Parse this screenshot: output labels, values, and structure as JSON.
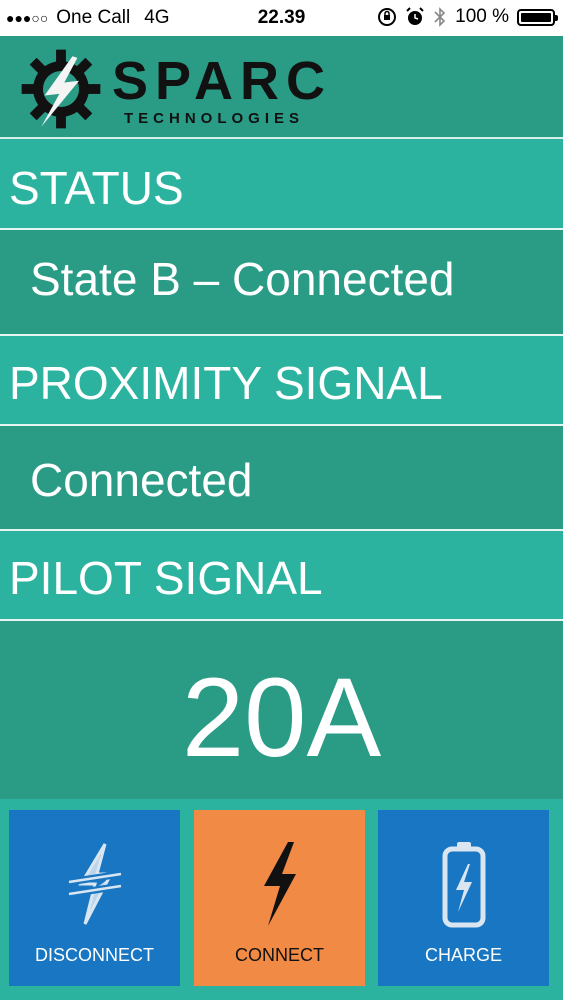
{
  "status_bar": {
    "signal_dots": "●●●○○",
    "carrier": "One Call",
    "network": "4G",
    "time": "22.39",
    "battery": "100 %"
  },
  "header": {
    "brand_name": "SPARC",
    "brand_sub": "TECHNOLOGIES"
  },
  "status": {
    "label": "STATUS",
    "value": "State B – Connected"
  },
  "proximity": {
    "label": "PROXIMITY SIGNAL",
    "value": "Connected"
  },
  "pilot": {
    "label": "PILOT SIGNAL",
    "value": "20A"
  },
  "buttons": {
    "disconnect": "DISCONNECT",
    "connect": "CONNECT",
    "charge": "CHARGE"
  },
  "colors": {
    "header_bg": "#2a9c86",
    "label_row_bg": "#2cb39f",
    "disconnect_btn": "#1976c2",
    "connect_btn": "#f08a45",
    "charge_btn": "#1976c2"
  }
}
